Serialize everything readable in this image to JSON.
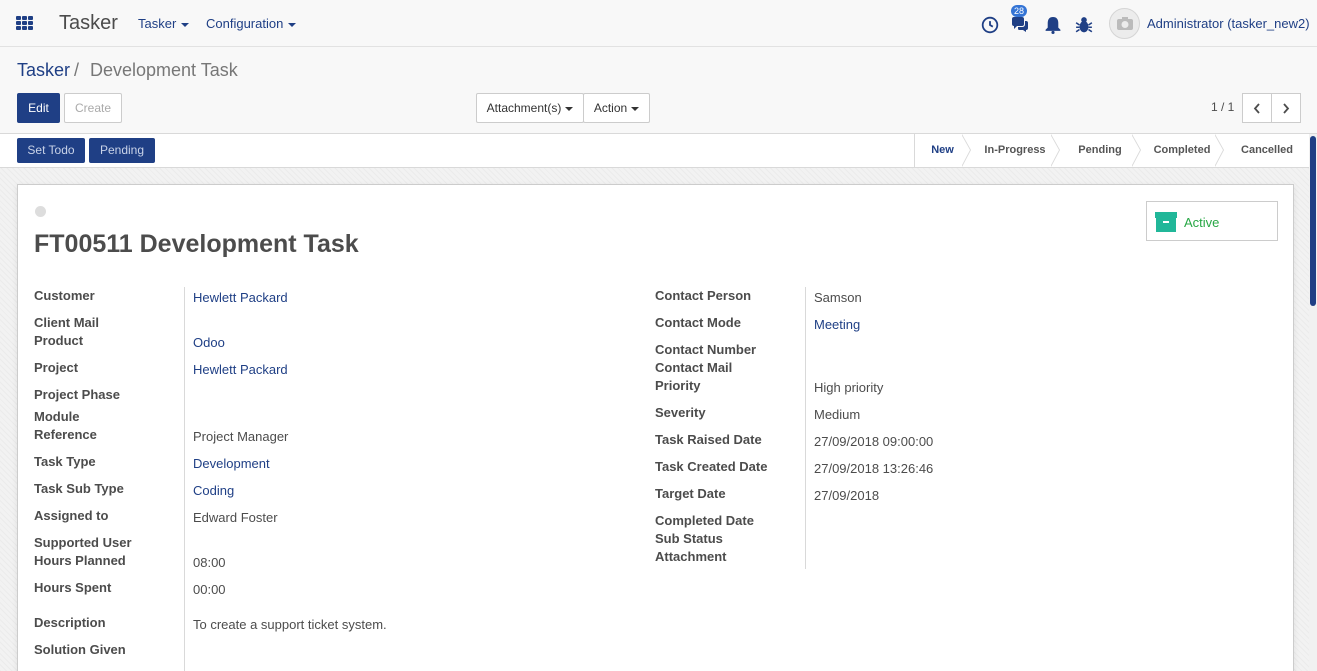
{
  "navbar": {
    "brand": "Tasker",
    "menus": [
      "Tasker",
      "Configuration"
    ],
    "message_count": "28",
    "user": "Administrator (tasker_new2)"
  },
  "breadcrumb": {
    "root": "Tasker",
    "separator": "/",
    "current": "Development Task"
  },
  "toolbar": {
    "edit": "Edit",
    "create": "Create",
    "attachments": "Attachment(s)",
    "action": "Action",
    "pager": "1 / 1"
  },
  "statusbar": {
    "buttons": [
      "Set Todo",
      "Pending"
    ],
    "stages": [
      "New",
      "In-Progress",
      "Pending",
      "Completed",
      "Cancelled"
    ],
    "active_stage": "New"
  },
  "record": {
    "title": "FT00511 Development Task",
    "active_label": "Active"
  },
  "left_fields": {
    "customer": {
      "label": "Customer",
      "value": "Hewlett Packard"
    },
    "client_mail": {
      "label": "Client Mail",
      "value": ""
    },
    "product": {
      "label": "Product",
      "value": "Odoo"
    },
    "project": {
      "label": "Project",
      "value": "Hewlett Packard"
    },
    "project_phase": {
      "label": "Project Phase",
      "value": ""
    },
    "module": {
      "label": "Module",
      "value": ""
    },
    "reference": {
      "label": "Reference",
      "value": "Project Manager"
    },
    "task_type": {
      "label": "Task Type",
      "value": "Development"
    },
    "task_sub_type": {
      "label": "Task Sub Type",
      "value": "Coding"
    },
    "assigned_to": {
      "label": "Assigned to",
      "value": "Edward Foster"
    },
    "supported_user": {
      "label": "Supported User",
      "value": ""
    },
    "hours_planned": {
      "label": "Hours Planned",
      "value": "08:00"
    },
    "hours_spent": {
      "label": "Hours Spent",
      "value": "00:00"
    },
    "description": {
      "label": "Description",
      "value": "To create a support ticket system."
    },
    "solution_given": {
      "label": "Solution Given",
      "value": ""
    }
  },
  "right_fields": {
    "contact_person": {
      "label": "Contact Person",
      "value": "Samson"
    },
    "contact_mode": {
      "label": "Contact Mode",
      "value": "Meeting"
    },
    "contact_number": {
      "label": "Contact Number",
      "value": ""
    },
    "contact_mail": {
      "label": "Contact Mail",
      "value": ""
    },
    "priority": {
      "label": "Priority",
      "value": "High priority"
    },
    "severity": {
      "label": "Severity",
      "value": "Medium"
    },
    "task_raised_date": {
      "label": "Task Raised Date",
      "value": "27/09/2018 09:00:00"
    },
    "task_created_date": {
      "label": "Task Created Date",
      "value": "27/09/2018 13:26:46"
    },
    "target_date": {
      "label": "Target Date",
      "value": "27/09/2018"
    },
    "completed_date": {
      "label": "Completed Date",
      "value": ""
    },
    "sub_status": {
      "label": "Sub Status",
      "value": ""
    },
    "attachment": {
      "label": "Attachment",
      "value": ""
    }
  },
  "colors": {
    "primary": "#1f3f85",
    "active_green": "#28a745",
    "badge": "#3474d5"
  }
}
